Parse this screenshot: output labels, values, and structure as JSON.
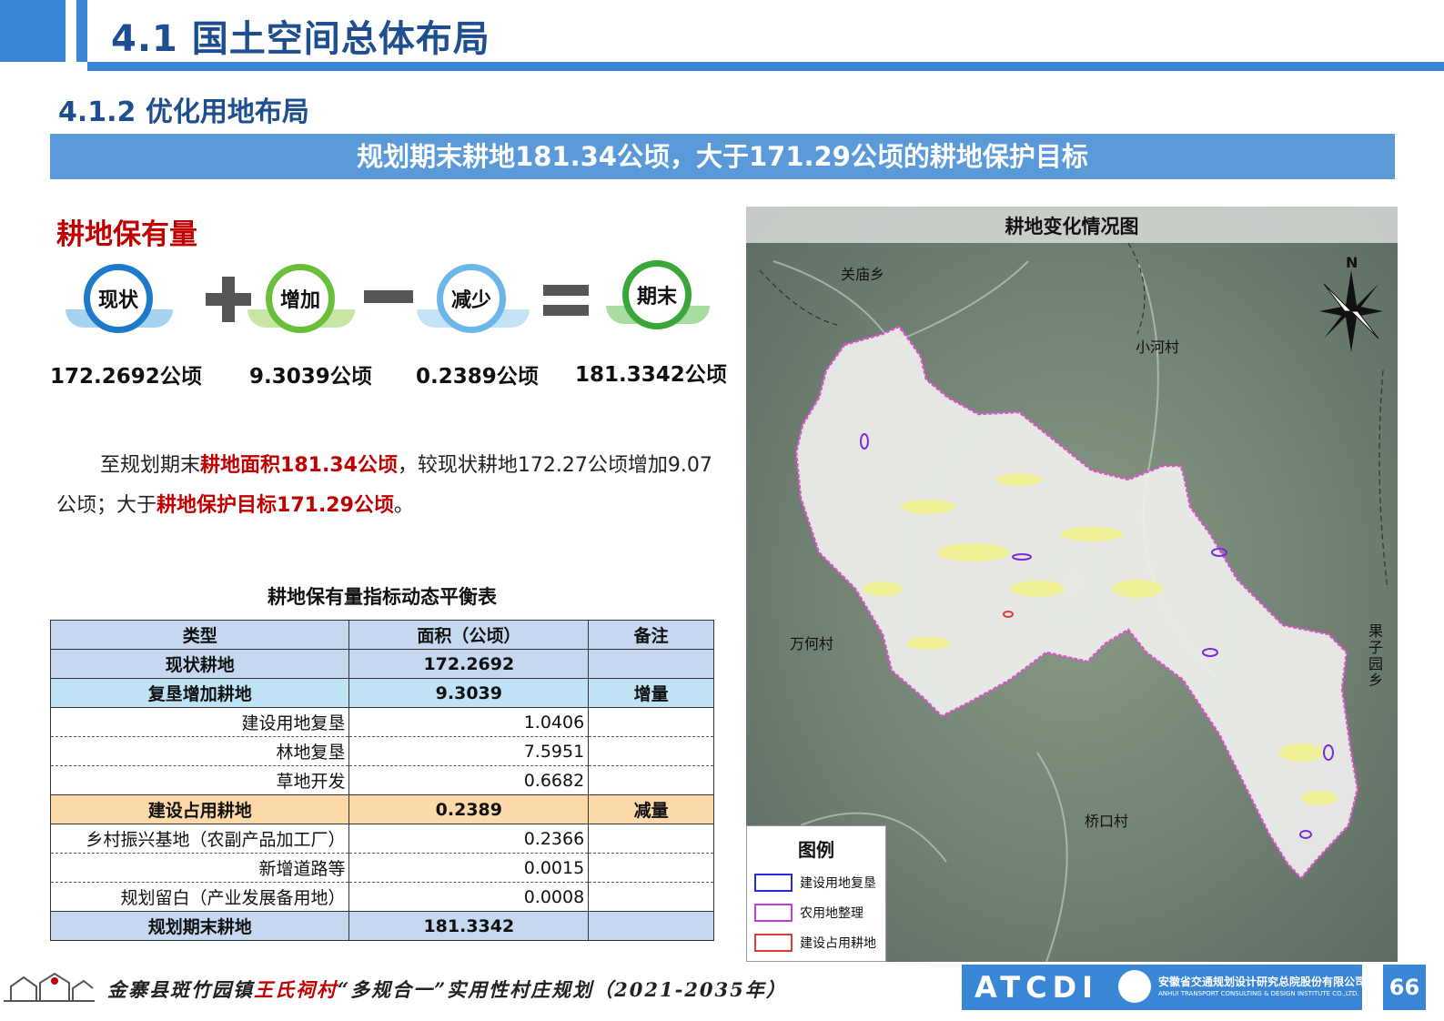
{
  "header": {
    "title": "4.1 国土空间总体布局",
    "subtitle": "4.1.2 优化用地布局",
    "banner": "规划期末耕地181.34公顷，大于171.29公顷的耕地保护目标"
  },
  "section": {
    "title": "耕地保有量"
  },
  "equation": {
    "items": [
      {
        "label": "现状",
        "value": "172.2692公顷",
        "color": "#1e79c9"
      },
      {
        "label": "增加",
        "value": "9.3039公顷",
        "color": "#6abf3a"
      },
      {
        "label": "减少",
        "value": "0.2389公顷",
        "color": "#6cb6e8"
      },
      {
        "label": "期末",
        "value": "181.3342公顷",
        "color": "#3aa63a"
      }
    ],
    "operators": [
      "plus",
      "minus",
      "equals"
    ]
  },
  "paragraph": {
    "p1": "至规划期末",
    "h1": "耕地面积181.34公顷",
    "p2": "，较现状耕地172.27公顷增加9.07公顷；大于",
    "h2": "耕地保护目标171.29公顷",
    "p3": "。"
  },
  "table": {
    "title": "耕地保有量指标动态平衡表",
    "headers": [
      "类型",
      "面积（公顷）",
      "备注"
    ],
    "rows": [
      {
        "type": "现状耕地",
        "area": "172.2692",
        "note": ""
      },
      {
        "type": "复垦增加耕地",
        "area": "9.3039",
        "note": "增量"
      },
      {
        "type": "建设用地复垦",
        "area": "1.0406",
        "note": ""
      },
      {
        "type": "林地复垦",
        "area": "7.5951",
        "note": ""
      },
      {
        "type": "草地开发",
        "area": "0.6682",
        "note": ""
      },
      {
        "type": "建设占用耕地",
        "area": "0.2389",
        "note": "减量"
      },
      {
        "type": "乡村振兴基地（农副产品加工厂）",
        "area": "0.2366",
        "note": ""
      },
      {
        "type": "新增道路等",
        "area": "0.0015",
        "note": ""
      },
      {
        "type": "规划留白（产业发展备用地）",
        "area": "0.0008",
        "note": ""
      },
      {
        "type": "规划期末耕地",
        "area": "181.3342",
        "note": ""
      }
    ]
  },
  "map": {
    "title": "耕地变化情况图",
    "labels": {
      "guanmiao": "关庙乡",
      "xiaohe": "小河村",
      "wanhe": "万何村",
      "guoziyuan": "果子园乡",
      "qiaokou": "桥口村"
    },
    "north": "N",
    "legend": {
      "title": "图例",
      "items": [
        {
          "label": "建设用地复垦",
          "color": "#2a2ad8"
        },
        {
          "label": "农用地整理",
          "color": "#c23ce0"
        },
        {
          "label": "建设占用耕地",
          "color": "#e03a3a"
        }
      ]
    }
  },
  "footer": {
    "t1": "金寨县斑竹园镇",
    "t2": "王氏祠村",
    "t3": "“多规合一”实用性村庄规划（2021-2035年）",
    "logo": "ATCDI",
    "company_cn": "安徽省交通规划设计研究总院股份有限公司",
    "company_en": "ANHUI TRANSPORT CONSULTING & DESIGN INSTITUTE CO.,LTD.",
    "page": "66"
  }
}
